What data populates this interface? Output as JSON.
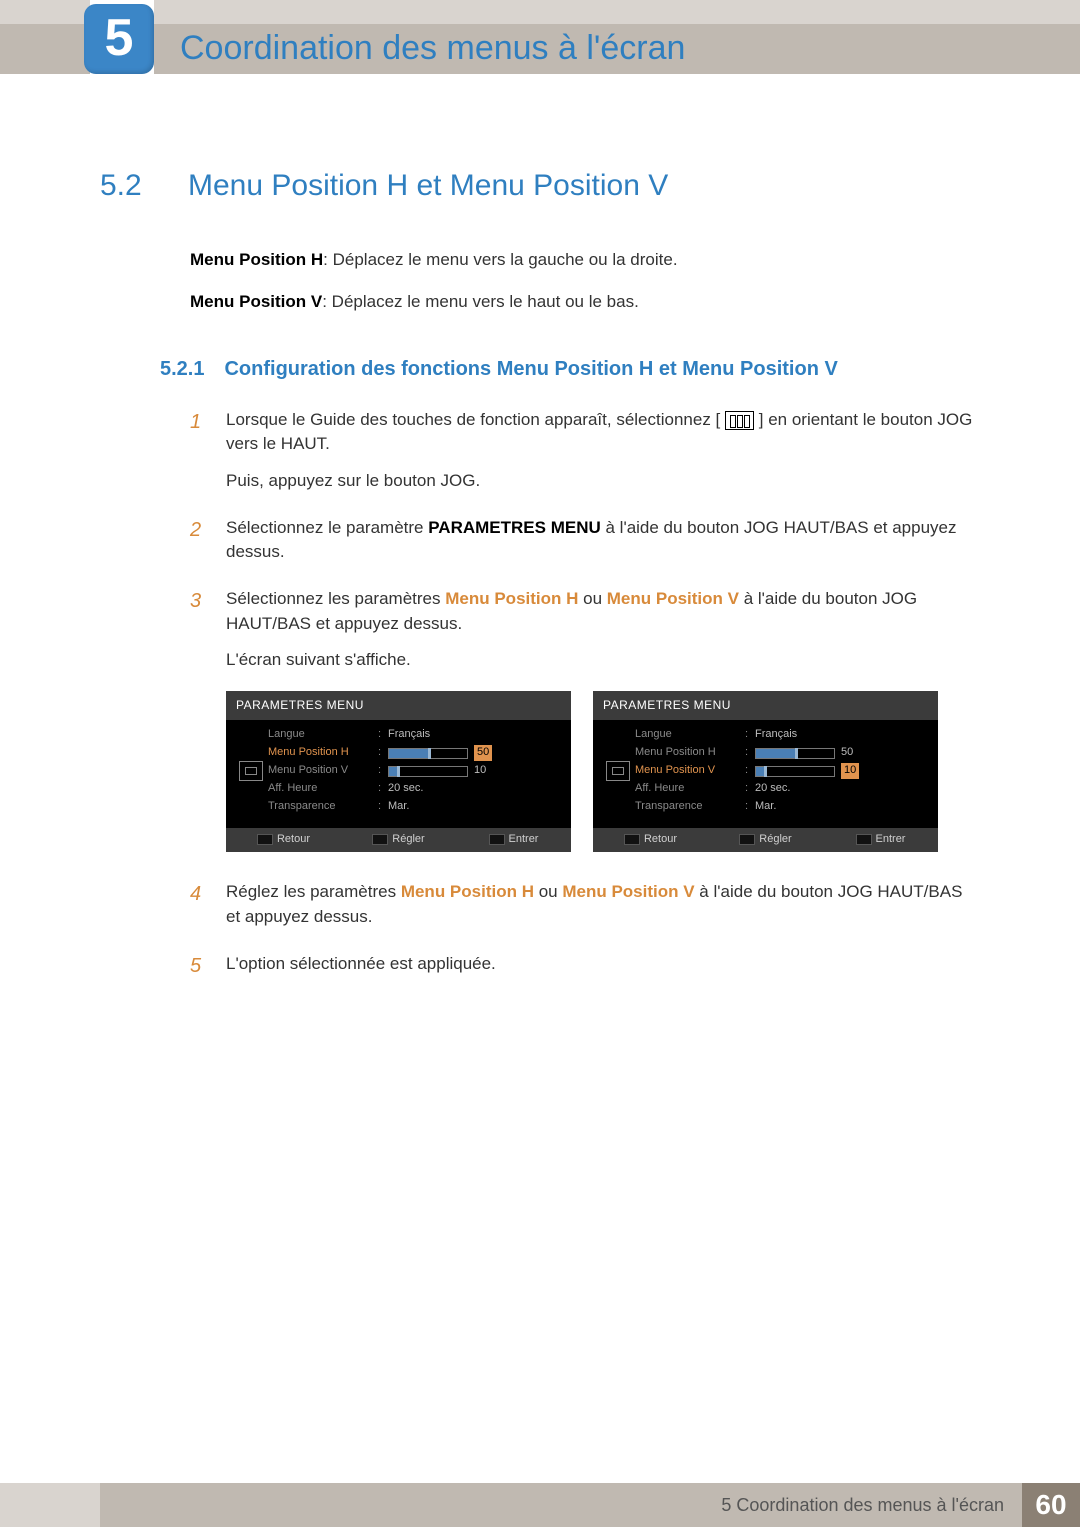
{
  "chapter": {
    "number": "5",
    "title": "Coordination des menus à l'écran"
  },
  "section": {
    "number": "5.2",
    "title": "Menu Position H et Menu Position V"
  },
  "intro": [
    {
      "label": "Menu Position H",
      "text": ": Déplacez le menu vers la gauche ou la droite."
    },
    {
      "label": "Menu Position V",
      "text": ": Déplacez le menu vers le haut ou le bas."
    }
  ],
  "subsection": {
    "number": "5.2.1",
    "title": "Configuration des fonctions Menu Position H et Menu Position V"
  },
  "steps": {
    "s1a1": "Lorsque le Guide des touches de fonction apparaît, sélectionnez [",
    "s1a2": "] en orientant le bouton JOG vers le HAUT.",
    "s1b": "Puis, appuyez sur le bouton JOG.",
    "s2a": "Sélectionnez le paramètre ",
    "s2bold": "PARAMETRES MENU",
    "s2b": " à l'aide du bouton JOG HAUT/BAS et appuyez dessus.",
    "s3a": "Sélectionnez les paramètres ",
    "s3h": "Menu Position H",
    "s3mid": " ou ",
    "s3v": "Menu Position V",
    "s3b": " à l'aide du bouton JOG HAUT/BAS et appuyez dessus.",
    "s3c": "L'écran suivant s'affiche.",
    "s4a": "Réglez les paramètres ",
    "s4b": " à l'aide du bouton JOG HAUT/BAS et appuyez dessus.",
    "s5": "L'option sélectionnée est appliquée."
  },
  "osd_labels": {
    "title": "PARAMETRES MENU",
    "langue": "Langue",
    "mph": "Menu Position H",
    "mpv": "Menu Position V",
    "aff": "Aff. Heure",
    "trans": "Transparence",
    "francais": "Français",
    "twenty": "20 sec.",
    "mar": "Mar.",
    "retour": "Retour",
    "regler": "Régler",
    "entrer": "Entrer",
    "v50": "50",
    "v10": "10"
  },
  "footer": {
    "left": "5 Coordination des menus à l'écran",
    "page": "60"
  }
}
